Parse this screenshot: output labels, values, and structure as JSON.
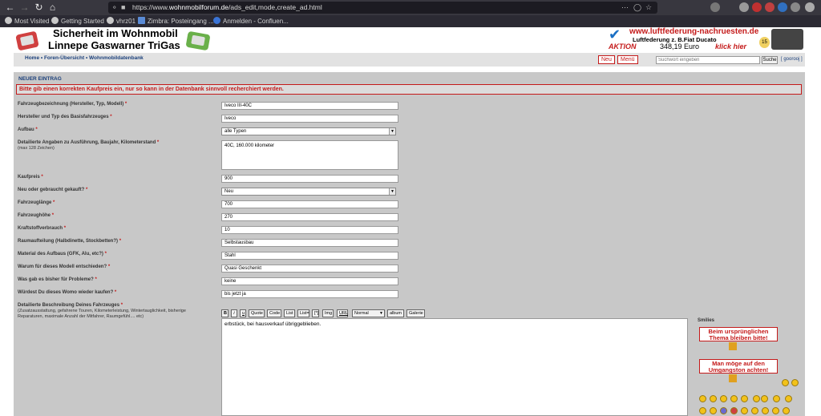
{
  "browser": {
    "url_prefix": "https://www.",
    "url_host": "wohnmobilforum.de",
    "url_path": "/ads_edit,mode,create_ad.html",
    "bookmarks": [
      {
        "label": "Most Visited"
      },
      {
        "label": "Getting Started"
      },
      {
        "label": "vhrz01"
      },
      {
        "label": "Zimbra: Posteingang ..."
      },
      {
        "label": "Anmelden - Confluen..."
      }
    ]
  },
  "header": {
    "title_line1": "Sicherheit im Wohnmobil",
    "title_line2": "Linnepe Gaswarner TriGas"
  },
  "ad": {
    "url": "www.luftfederung-nachruesten.de",
    "line": "Luftfederung z. B.Fiat Ducato",
    "price": "348,19 Euro",
    "aktion": "AKTION",
    "cta": "klick hier",
    "badge": "15"
  },
  "nav": {
    "breadcrumb": "Home • Foren-Übersicht • Wohnmobildatenbank",
    "new_label": "Neu",
    "menu_label": "Menü",
    "search_placeholder": "Suchwort eingeben",
    "search_button": "Suche",
    "user_link": "[ goorooj ]"
  },
  "form": {
    "section_title": "NEUER EINTRAG",
    "warning": "Bitte gib einen korrekten Kaufpreis ein, nur so kann in der Datenbank sinnvoll recherchiert werden.",
    "fields": {
      "bezeichnung": {
        "label": "Fahrzeugbezeichnung (Hersteller, Typ, Modell)",
        "value": "Iveco III-40C"
      },
      "basis": {
        "label": "Hersteller und Typ des Basisfahrzeuges",
        "value": "Iveco"
      },
      "aufbau": {
        "label": "Aufbau",
        "value": "alle Typen"
      },
      "angaben": {
        "label": "Detailierte Angaben zu Ausführung, Baujahr, Kilometerstand",
        "sub": "(max 128 Zeichen)",
        "value": "40C, 160.000 kilometer"
      },
      "kaufpreis": {
        "label": "Kaufpreis",
        "value": "900"
      },
      "neu": {
        "label": "Neu oder gebraucht gekauft?",
        "value": "Neu"
      },
      "laenge": {
        "label": "Fahrzeuglänge",
        "value": "700"
      },
      "hoehe": {
        "label": "Fahrzeughöhe",
        "value": "270"
      },
      "verbrauch": {
        "label": "Kraftstoffverbrauch",
        "value": "10"
      },
      "raum": {
        "label": "Raumaufteilung (Halbdinette, Stockbetten?)",
        "value": "Selbstausbau"
      },
      "material": {
        "label": "Material des Aufbaus (GFK, Alu, etc?)",
        "value": "Stahl"
      },
      "warum": {
        "label": "Warum für dieses Modell entschieden?",
        "value": "Quasi Geschenkt"
      },
      "probleme": {
        "label": "Was gab es bisher für Probleme?",
        "value": "keine"
      },
      "wieder": {
        "label": "Würdest Du dieses Womo wieder kaufen?",
        "value": "bis jetzt ja"
      }
    },
    "beschreibung": {
      "label": "Detailierte Beschreibung Deines Fahrzeuges",
      "sub1": "(Zusatzausstattung, gefahrene Touren, Kilometerleistung, Wintertauglichkeit, bisherige",
      "sub2": "Reparaturen, maximale Anzahl der Mitfahrer, Raumgefühl.... etc)",
      "value": "erbstück, bei hausverkauf übriggeblieben."
    },
    "required_mark": "*",
    "editor": {
      "bold": "B",
      "italic": "i",
      "underline": "u",
      "quote": "Quote",
      "code": "Code",
      "list": "List",
      "list_eq": "List=",
      "star": "[*]",
      "img": "Img",
      "url": "URL",
      "size": "Normal",
      "album": "album",
      "galerie": "Galerie"
    }
  },
  "smilies": {
    "title": "Smilies",
    "sign1": "Beim ursprünglichen Thema bleiben bitte!",
    "sign2": "Man möge auf den Umgangston achten!"
  },
  "colors": {
    "accent_red": "#c41a1a",
    "link_blue": "#1a3f7a",
    "form_bg": "#c8c8c8"
  }
}
